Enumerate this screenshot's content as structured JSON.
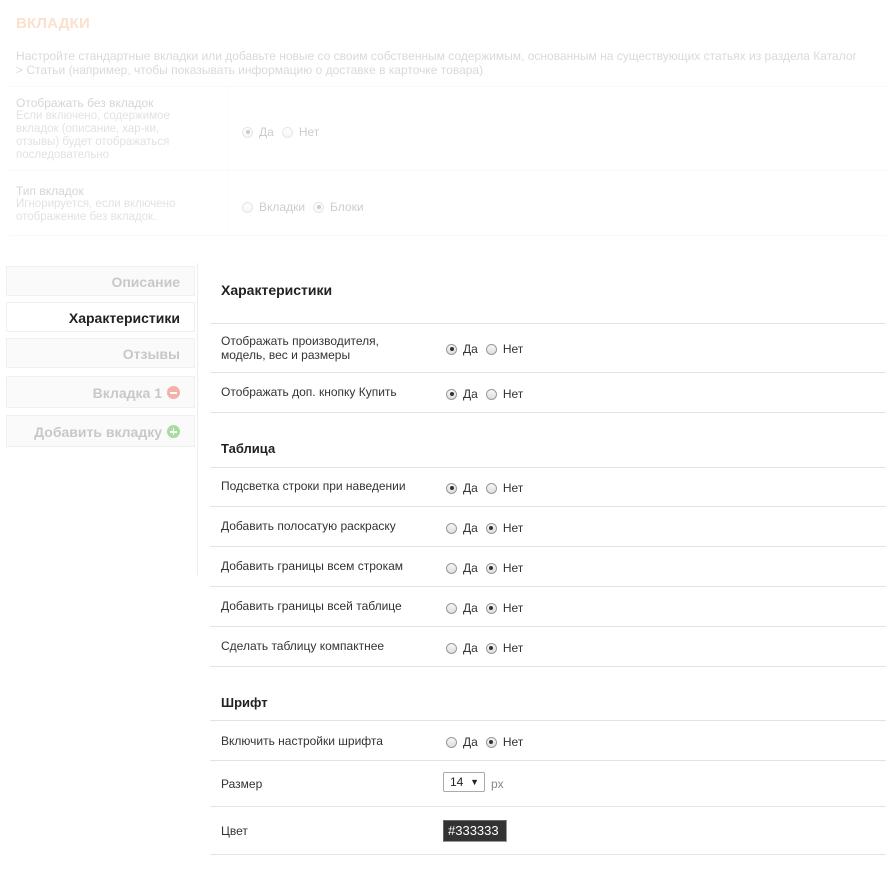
{
  "header": {
    "title": "ВКЛАДКИ",
    "description": "Настройте стандартные вкладки или добавьте новые со своим собственным содержимым, основанным на существующих статьях из раздела Каталог > Статьи (например, чтобы показывать информацию о доставке в карточке товара)"
  },
  "top_settings": {
    "no_tabs": {
      "label": "Отображать без вкладок",
      "help": "Если включено, содержимое вкладок (описание, хар-ки, отзывы) будет отображаться последовательно",
      "options": [
        "Да",
        "Нет"
      ],
      "selected": "Да"
    },
    "tab_type": {
      "label": "Тип вкладок",
      "help": "Игнорируется, если включено отображение без вкладок.",
      "options": [
        "Вкладки",
        "Блоки"
      ],
      "selected": "Блоки"
    }
  },
  "tabs": [
    {
      "label": "Описание",
      "active": false
    },
    {
      "label": "Характеристики",
      "active": true
    },
    {
      "label": "Отзывы",
      "active": false
    },
    {
      "label": "Вкладка 1",
      "active": false,
      "icon": "remove-icon"
    },
    {
      "label": "Добавить вкладку",
      "active": false,
      "icon": "add-icon"
    }
  ],
  "panel": {
    "title": "Характеристики",
    "rows_main": [
      {
        "label": "Отображать производителя, модель, вес и размеры",
        "options": [
          "Да",
          "Нет"
        ],
        "selected": "Да"
      },
      {
        "label": "Отображать доп. кнопку Купить",
        "options": [
          "Да",
          "Нет"
        ],
        "selected": "Да"
      }
    ],
    "table_section": {
      "title": "Таблица",
      "rows": [
        {
          "label": "Подсветка строки при наведении",
          "options": [
            "Да",
            "Нет"
          ],
          "selected": "Да"
        },
        {
          "label": "Добавить полосатую раскраску",
          "options": [
            "Да",
            "Нет"
          ],
          "selected": "Нет"
        },
        {
          "label": "Добавить границы всем строкам",
          "options": [
            "Да",
            "Нет"
          ],
          "selected": "Нет"
        },
        {
          "label": "Добавить границы всей таблице",
          "options": [
            "Да",
            "Нет"
          ],
          "selected": "Нет"
        },
        {
          "label": "Сделать таблицу компактнее",
          "options": [
            "Да",
            "Нет"
          ],
          "selected": "Нет"
        }
      ]
    },
    "font_section": {
      "title": "Шрифт",
      "enable": {
        "label": "Включить настройки шрифта",
        "options": [
          "Да",
          "Нет"
        ],
        "selected": "Нет"
      },
      "size": {
        "label": "Размер",
        "value": "14",
        "unit": "px"
      },
      "color": {
        "label": "Цвет",
        "value": "#333333"
      }
    }
  },
  "colors": {
    "accent": "#f08030",
    "text": "#333333"
  }
}
